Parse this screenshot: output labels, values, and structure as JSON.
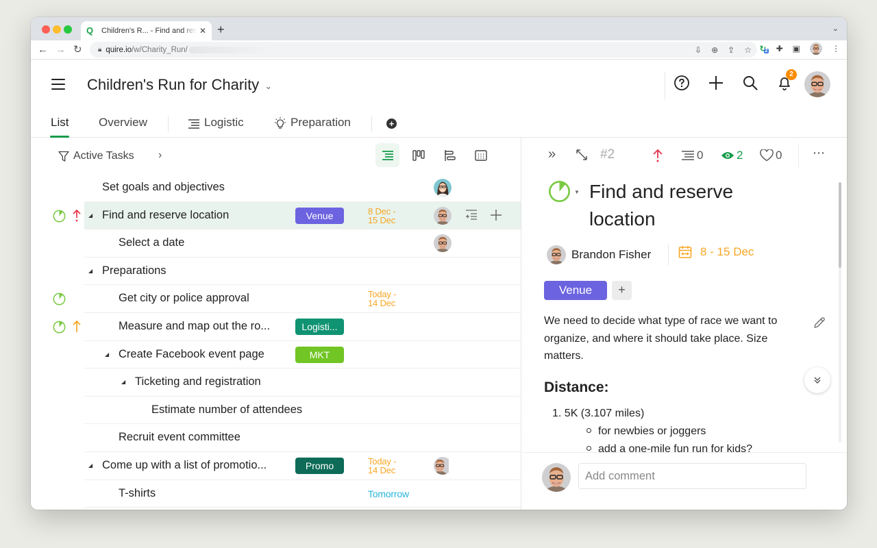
{
  "browser": {
    "tab_title": "Children's R... - Find and reserve location",
    "tab_favicon": "Q",
    "url_host": "quire.io",
    "url_path": "/w/Charity_Run/",
    "extension_badge": "2"
  },
  "header": {
    "project_title": "Children's Run for Charity",
    "notification_count": "2"
  },
  "tabs": [
    {
      "label": "List",
      "active": true
    },
    {
      "label": "Overview"
    },
    {
      "label": "Logistic",
      "icon": "list-lines-icon"
    },
    {
      "label": "Preparation",
      "icon": "lightbulb-icon"
    }
  ],
  "toolbar": {
    "filter_label": "Active Tasks",
    "views": [
      "list-view",
      "board-view",
      "timeline-view",
      "calendar-view"
    ],
    "active_view": "list-view"
  },
  "colors": {
    "accent_green": "#139b4a",
    "status_green": "#7ac943",
    "priority_urgent": "#e8334a",
    "priority_high": "#f6a623",
    "date_orange": "#f6a623",
    "date_blue": "#26b5d9",
    "tag_venue": "#6c63e0",
    "tag_logistic": "#109372",
    "tag_mkt": "#71c524",
    "tag_promo": "#0d6b57"
  },
  "tasks": [
    {
      "name": "Set goals and objectives",
      "indent": 1,
      "assignee": "woman-avatar"
    },
    {
      "name": "Find and reserve location",
      "indent": 1,
      "expandable": true,
      "selected": true,
      "status": "in-progress",
      "priority": "urgent",
      "tag": "Venue",
      "date_line1": "8 Dec -",
      "date_line2": "15 Dec",
      "assignee": "man-avatar"
    },
    {
      "name": "Select a date",
      "indent": 2,
      "assignee": "man-avatar"
    },
    {
      "name": "Preparations",
      "indent": 1,
      "expandable": true
    },
    {
      "name": "Get city or police approval",
      "indent": 2,
      "status": "in-progress",
      "date_line1": "Today -",
      "date_line2": "14 Dec"
    },
    {
      "name": "Measure and map out the ro...",
      "indent": 2,
      "status": "in-progress",
      "priority": "high",
      "tag": "Logisti..."
    },
    {
      "name": "Create Facebook event page",
      "indent": 2,
      "expandable": true,
      "tag": "MKT"
    },
    {
      "name": "Ticketing and registration",
      "indent": 3,
      "expandable": true
    },
    {
      "name": "Estimate number of attendees",
      "indent": 4
    },
    {
      "name": "Recruit event committee",
      "indent": 2
    },
    {
      "name": "Come up with a list of promotio...",
      "indent": 1,
      "expandable": true,
      "tag": "Promo",
      "date_line1": "Today -",
      "date_line2": "14 Dec",
      "assignee": "group-avatar"
    },
    {
      "name": "T-shirts",
      "indent": 2,
      "date_single": "Tomorrow"
    }
  ],
  "detail": {
    "task_id": "#2",
    "subtask_count": "0",
    "watchers_count": "2",
    "likes_count": "0",
    "title": "Find and reserve location",
    "assignee": "Brandon Fisher",
    "date_range": "8 - 15 Dec",
    "tag": "Venue",
    "description": "We need to decide what type of race we want to organize, and where it should take place. Size matters.",
    "section_heading": "Distance:",
    "list_item_1": "1. 5K (3.107 miles)",
    "sub_item_1": "for newbies or joggers",
    "sub_item_2": "add a one-mile fun run for kids?",
    "comment_placeholder": "Add comment"
  }
}
